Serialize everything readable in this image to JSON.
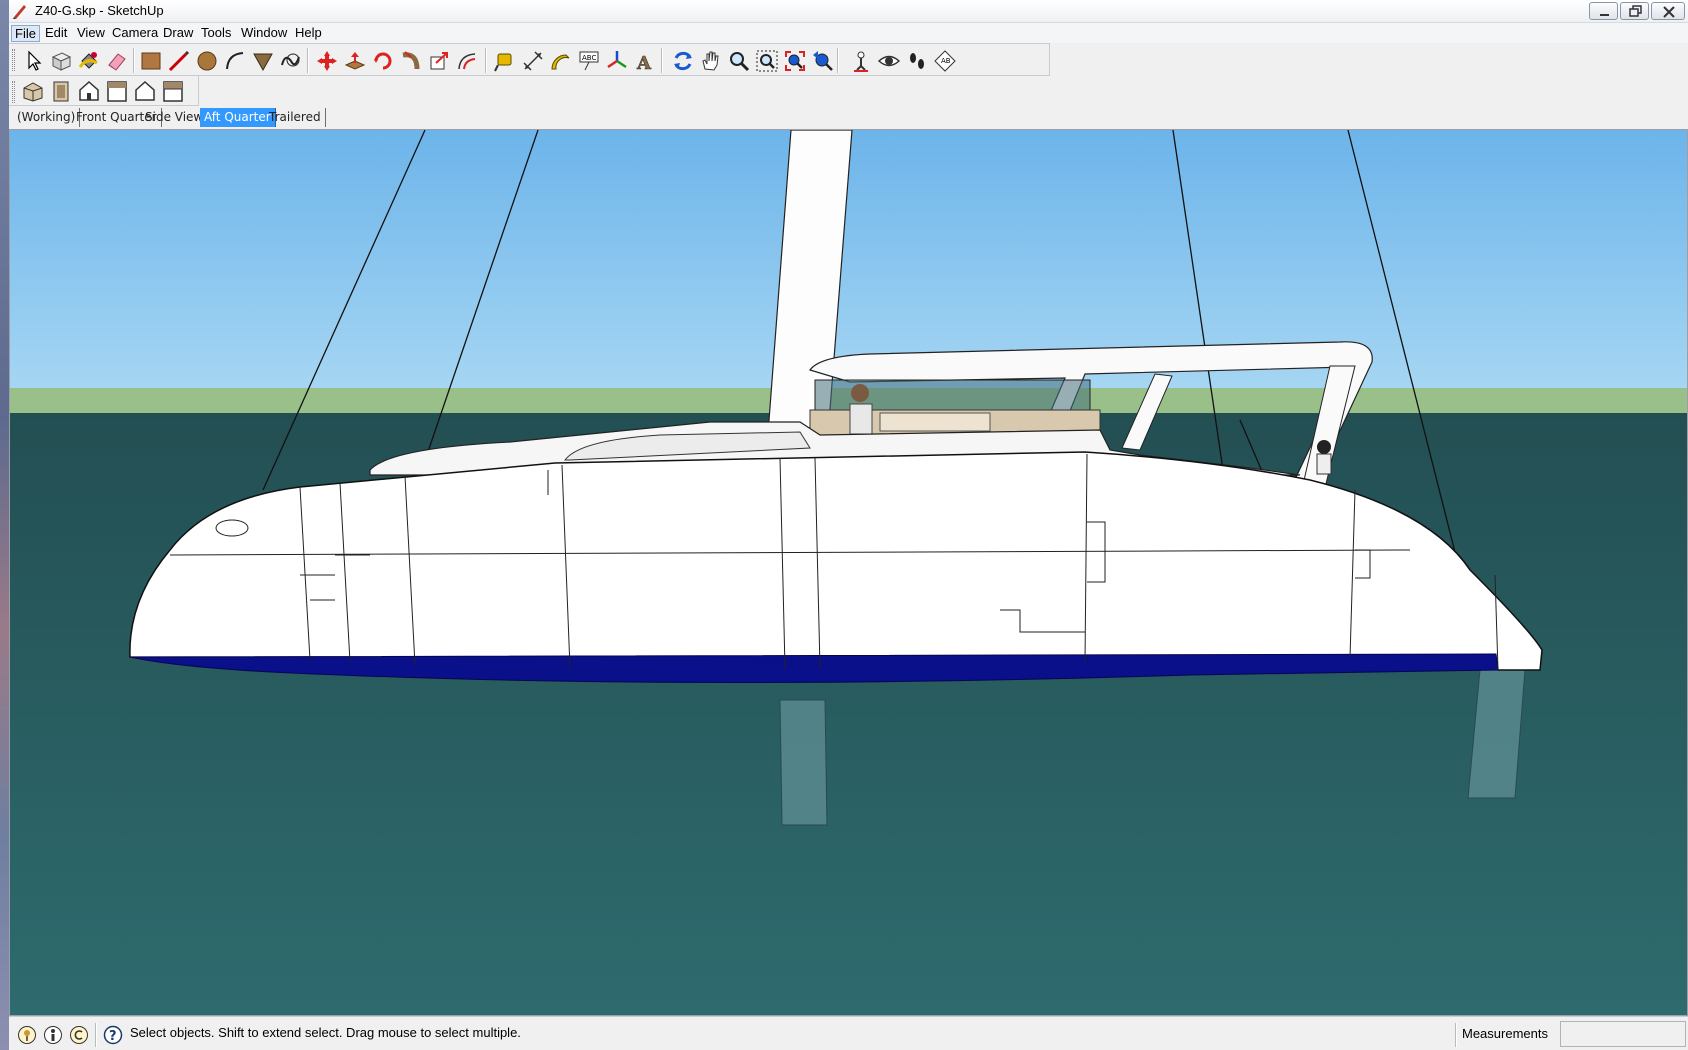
{
  "window": {
    "title": "Z40-G.skp - SketchUp"
  },
  "menu": [
    "File",
    "Edit",
    "View",
    "Camera",
    "Draw",
    "Tools",
    "Window",
    "Help"
  ],
  "toolbar": {
    "main_tools": [
      {
        "icon": "select-arrow-icon"
      },
      {
        "icon": "make-component-icon"
      },
      {
        "icon": "paint-bucket-icon"
      },
      {
        "icon": "eraser-icon"
      },
      {
        "icon": "rectangle-icon"
      },
      {
        "icon": "pencil-line-icon"
      },
      {
        "icon": "circle-icon"
      },
      {
        "icon": "arc-icon"
      },
      {
        "icon": "polygon-icon"
      },
      {
        "icon": "freehand-icon"
      },
      {
        "icon": "move-icon"
      },
      {
        "icon": "push-pull-icon"
      },
      {
        "icon": "rotate-icon"
      },
      {
        "icon": "follow-me-icon"
      },
      {
        "icon": "scale-icon"
      },
      {
        "icon": "offset-icon"
      },
      {
        "icon": "tape-measure-icon"
      },
      {
        "icon": "dimension-icon"
      },
      {
        "icon": "protractor-icon"
      },
      {
        "icon": "text-label-icon"
      },
      {
        "icon": "axes-icon"
      },
      {
        "icon": "3d-text-icon"
      },
      {
        "icon": "orbit-icon"
      },
      {
        "icon": "pan-hand-icon"
      },
      {
        "icon": "zoom-icon"
      },
      {
        "icon": "zoom-window-icon"
      },
      {
        "icon": "zoom-extents-icon"
      },
      {
        "icon": "previous-view-icon"
      },
      {
        "icon": "position-camera-icon"
      },
      {
        "icon": "look-around-icon"
      },
      {
        "icon": "walk-icon"
      },
      {
        "icon": "section-plane-icon"
      }
    ],
    "view_tools": [
      {
        "icon": "iso-view-icon"
      },
      {
        "icon": "top-view-icon"
      },
      {
        "icon": "front-view-icon"
      },
      {
        "icon": "right-view-icon"
      },
      {
        "icon": "back-view-icon"
      },
      {
        "icon": "left-view-icon"
      }
    ]
  },
  "scenes": {
    "tabs": [
      "(Working)",
      "Front Quarter",
      "Side View",
      "Aft Quarter",
      "Trailered"
    ],
    "active": "Aft Quarter"
  },
  "status": {
    "icons": [
      "geo-location-icon",
      "credits-icon",
      "copyright-icon"
    ],
    "message": "Select objects. Shift to extend select. Drag mouse to select multiple.",
    "measurements_label": "Measurements",
    "measurements_value": ""
  },
  "colors": {
    "sky": "#7ab8e6",
    "horizon_band": "#9ac08a",
    "sea": "#2c6a6a",
    "hull": "#ffffff",
    "boot_stripe": "#0a108a",
    "active_tab": "#3399ff"
  }
}
